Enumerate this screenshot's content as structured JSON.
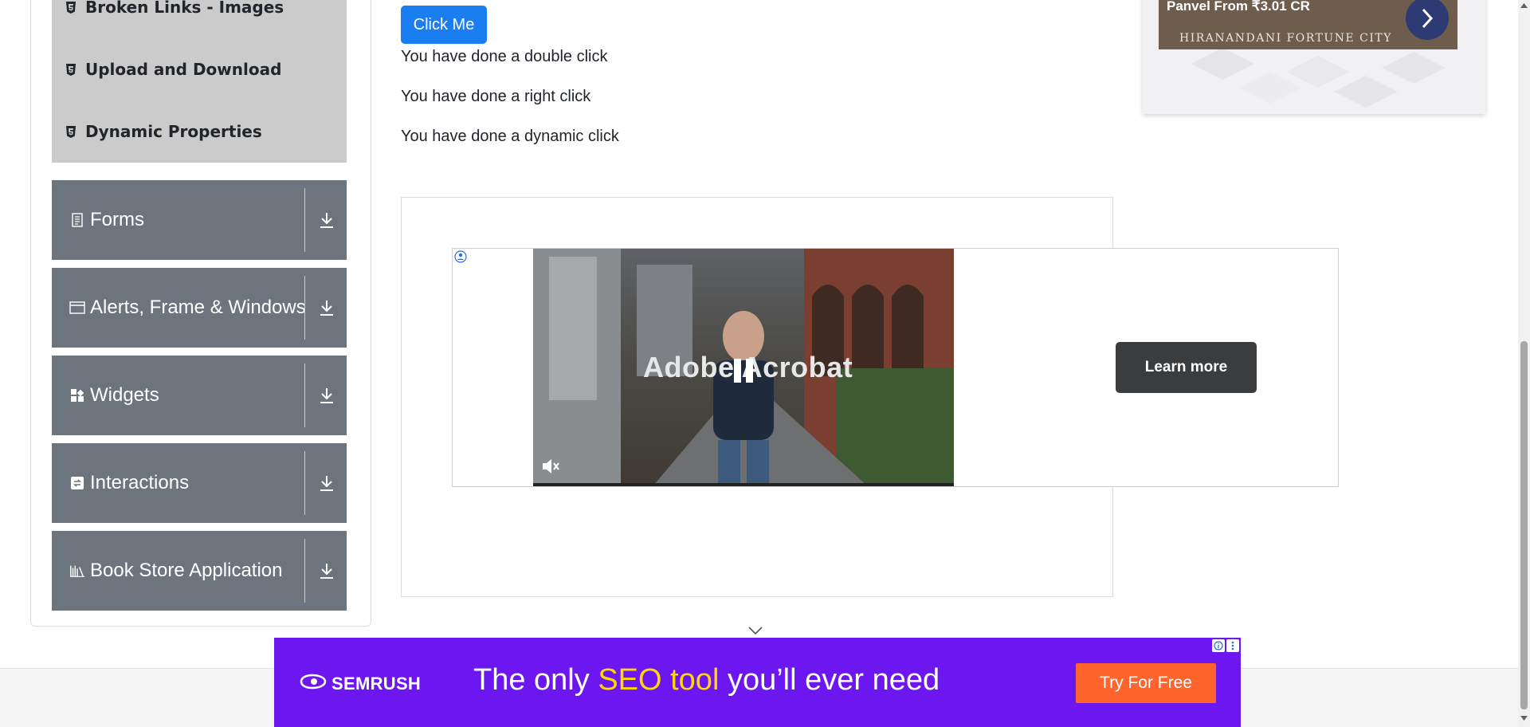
{
  "sidebar": {
    "subitems": [
      {
        "label": "Broken Links - Images"
      },
      {
        "label": "Upload and Download"
      },
      {
        "label": "Dynamic Properties"
      }
    ],
    "groups": [
      {
        "label": "Forms",
        "icon": "document-icon"
      },
      {
        "label": "Alerts, Frame & Windows",
        "icon": "window-icon"
      },
      {
        "label": "Widgets",
        "icon": "widgets-icon"
      },
      {
        "label": "Interactions",
        "icon": "interactions-icon"
      },
      {
        "label": "Book Store Application",
        "icon": "books-icon"
      }
    ]
  },
  "main": {
    "click_button": "Click Me",
    "messages": [
      "You have done a double click",
      "You have done a right click",
      "You have done a dynamic click"
    ]
  },
  "ads": {
    "top_right": {
      "title": "Panvel From ₹3.01 CR",
      "subtitle": "HIRANANDANI FORTUNE CITY"
    },
    "video": {
      "brand_text": "Adobe Acrobat",
      "cta": "Learn more"
    },
    "banner": {
      "brand": "SEMRUSH",
      "headline_pre": "The only ",
      "headline_highlight": "SEO tool",
      "headline_post": " you’ll ever need",
      "cta": "Try For Free",
      "highlight_color": "#ffd60a",
      "background_color": "#6d17f0"
    }
  },
  "colors": {
    "group_bg": "#6c757d",
    "subitem_bg": "#cbcbcb",
    "primary_button": "#1a7df0"
  }
}
